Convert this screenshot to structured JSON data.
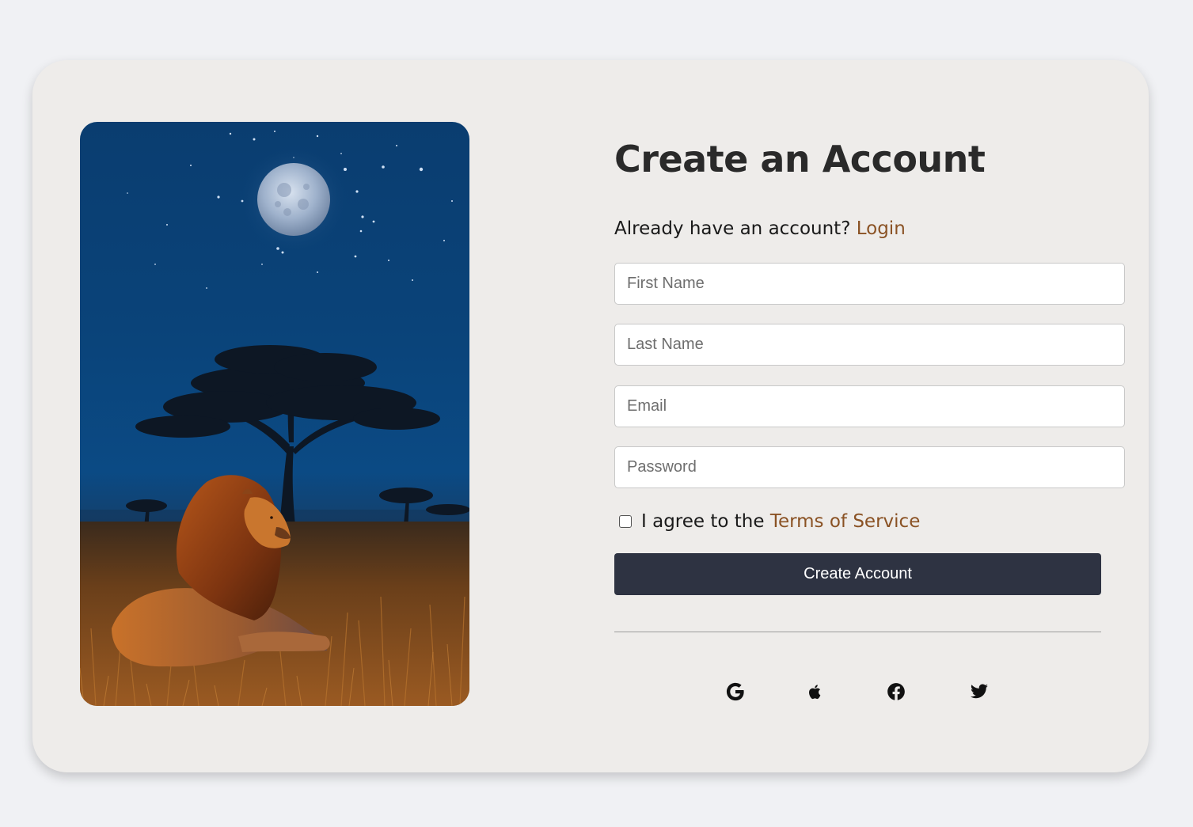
{
  "header": {
    "title": "Create an Account",
    "login_prompt": "Already have an account?",
    "login_link": "Login"
  },
  "form": {
    "first_name": {
      "placeholder": "First Name",
      "value": ""
    },
    "last_name": {
      "placeholder": "Last Name",
      "value": ""
    },
    "email": {
      "placeholder": "Email",
      "value": ""
    },
    "password": {
      "placeholder": "Password",
      "value": ""
    },
    "terms": {
      "checked": false,
      "prefix": "I agree to the",
      "link": "Terms of Service"
    },
    "submit_label": "Create Account"
  },
  "social_icons": [
    "google-icon",
    "apple-icon",
    "facebook-icon",
    "twitter-icon"
  ],
  "colors": {
    "page_background": "#f0f1f4",
    "card_background": "#eeecea",
    "accent_link": "#8a5224",
    "button_background": "#2e3342",
    "title_text": "#2a2a2a"
  }
}
